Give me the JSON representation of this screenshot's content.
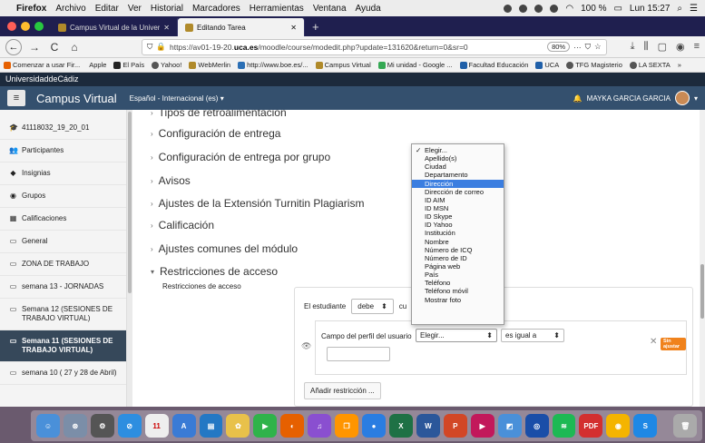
{
  "menubar": {
    "app": "Firefox",
    "items": [
      "Archivo",
      "Editar",
      "Ver",
      "Historial",
      "Marcadores",
      "Herramientas",
      "Ventana",
      "Ayuda"
    ],
    "battery": "100 %",
    "clock": "Lun 15:27"
  },
  "tabs": [
    {
      "title": "Campus Virtual de la Universid"
    },
    {
      "title": "Editando Tarea"
    }
  ],
  "navbar": {
    "url_prefix": "https://av01-19-20.",
    "url_domain": "uca.es",
    "url_suffix": "/moodle/course/modedit.php?update=131620&return=0&sr=0",
    "zoom": "80%"
  },
  "bookmarks": [
    "Comenzar a usar Fir...",
    "Apple",
    "El País",
    "Yahoo!",
    "WebMerlin",
    "http://www.boe.es/...",
    "Campus Virtual",
    "Mi unidad - Google ...",
    "Facultad Educación",
    "UCA",
    "TFG Magisterio",
    "LA SEXTA"
  ],
  "site": {
    "university": "UniversidaddeCádiz",
    "brand": "Campus Virtual",
    "language": "Español - Internacional (es) ▾",
    "user": "MAYKA GARCIA GARCIA"
  },
  "drawer": {
    "items": [
      {
        "icon": "cap-icon",
        "glyph": "🎓",
        "label": "41118032_19_20_01"
      },
      {
        "icon": "users-icon",
        "glyph": "👥",
        "label": "Participantes"
      },
      {
        "icon": "badge-icon",
        "glyph": "◆",
        "label": "Insignias"
      },
      {
        "icon": "groups-icon",
        "glyph": "◉",
        "label": "Grupos"
      },
      {
        "icon": "grades-icon",
        "glyph": "▦",
        "label": "Calificaciones"
      },
      {
        "icon": "folder-icon",
        "glyph": "▭",
        "label": "General"
      },
      {
        "icon": "folder-icon",
        "glyph": "▭",
        "label": "ZONA DE TRABAJO"
      },
      {
        "icon": "folder-icon",
        "glyph": "▭",
        "label": "semana 13 - JORNADAS"
      },
      {
        "icon": "folder-icon",
        "glyph": "▭",
        "label": "Semana 12 (SESIONES DE TRABAJO VIRTUAL)"
      },
      {
        "icon": "folder-icon",
        "glyph": "▭",
        "label": "Semana 11 (SESIONES DE TRABAJO VIRTUAL)"
      },
      {
        "icon": "folder-icon",
        "glyph": "▭",
        "label": "semana 10 ( 27 y 28 de Abril)"
      }
    ]
  },
  "sections": [
    {
      "label": "Tipos de retroalimentación"
    },
    {
      "label": "Configuración de entrega"
    },
    {
      "label": "Configuración de entrega por grupo"
    },
    {
      "label": "Avisos"
    },
    {
      "label": "Ajustes de la Extensión Turnitin Plagiarism"
    },
    {
      "label": "Calificación"
    },
    {
      "label": "Ajustes comunes del módulo"
    },
    {
      "label": "Restricciones de acceso"
    }
  ],
  "restrictions": {
    "label": "Restricciones de acceso",
    "student_text": "El estudiante",
    "must_value": "debe",
    "cut_text": "cu",
    "field_label": "Campo del perfil del usuario",
    "field_value": "Elegir...",
    "operator_value": "es igual a",
    "warn_badge": "Sin ajustar",
    "add_button": "Añadir restricción ..."
  },
  "dropdown": {
    "options": [
      "Elegir...",
      "Apellido(s)",
      "Ciudad",
      "Departamento",
      "Dirección",
      "Dirección de correo",
      "ID AIM",
      "ID MSN",
      "ID Skype",
      "ID Yahoo",
      "Institución",
      "Nombre",
      "Número de ICQ",
      "Número de ID",
      "Página web",
      "País",
      "Teléfono",
      "Teléfono móvil",
      "Mostrar foto"
    ],
    "checked_index": 0,
    "highlighted_index": 4
  },
  "colors": {
    "moodle_nav": "#34506e",
    "active_drawer": "#36485a",
    "highlight": "#3b7ee0",
    "warn": "#f0821c"
  }
}
